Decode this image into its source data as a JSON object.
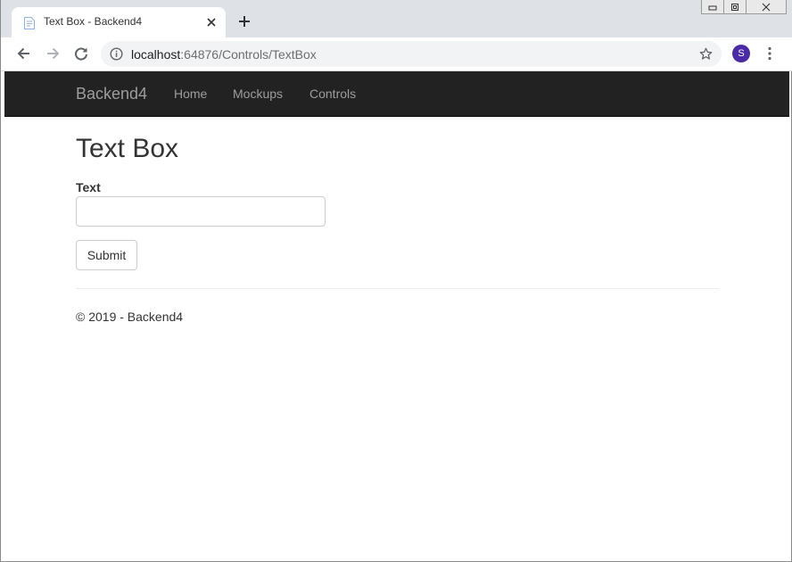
{
  "browser": {
    "tab_title": "Text Box - Backend4",
    "url_host": "localhost",
    "url_rest": ":64876/Controls/TextBox",
    "profile_initial": "S",
    "profile_color": "#4b2aa8"
  },
  "navbar": {
    "brand": "Backend4",
    "links": [
      "Home",
      "Mockups",
      "Controls"
    ],
    "background": "#222222"
  },
  "page": {
    "title": "Text Box",
    "field_label": "Text",
    "field_value": "",
    "submit_label": "Submit"
  },
  "footer": {
    "text": "© 2019 - Backend4"
  },
  "icons": {
    "tab": "page-favicon",
    "close_tab": "close-icon",
    "new_tab": "plus-icon",
    "back": "arrow-left-icon",
    "forward": "arrow-right-icon",
    "reload": "reload-icon",
    "site_info": "info-icon",
    "bookmark": "star-icon",
    "menu": "kebab-menu-icon"
  }
}
